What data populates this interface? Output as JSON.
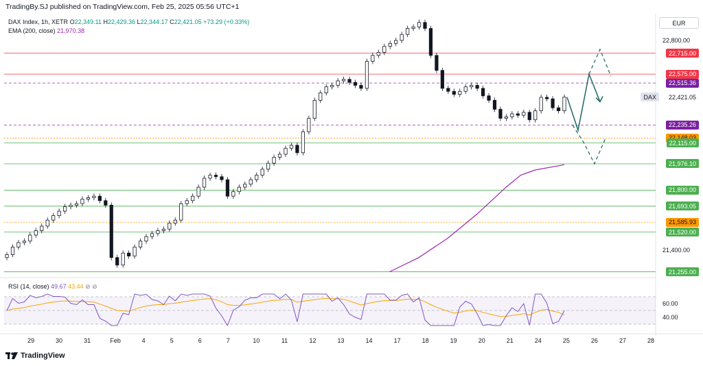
{
  "header": {
    "published": "TradingBy.SJ published on TradingView.com, Feb 25, 2025 05:56 UTC+1"
  },
  "legend": {
    "symbol": "DAX Index, 1h, XETR",
    "o_label": "O",
    "o_value": "22,349.11",
    "h_label": "H",
    "h_value": "22,429.36",
    "l_label": "L",
    "l_value": "22,344.17",
    "c_label": "C",
    "c_value": "22,421.05",
    "change": "+73.29 (+0.33%)",
    "ema_label": "EMA (200, close)",
    "ema_value": "21,970.38"
  },
  "rsi_legend": {
    "label": "RSI (14, close)",
    "value": "49.67",
    "ma_value": "43.44",
    "icons": "⊘ ⊘"
  },
  "currency": "EUR",
  "footer": {
    "brand": "TradingView"
  },
  "colors": {
    "up": "#089981",
    "down": "#131722",
    "ema": "#9c27b0",
    "red_line": "#f23645",
    "green_line": "#4caf50",
    "purple_dash": "#9c27b0",
    "orange_dot": "#ff9800",
    "projection": "#2a6f6b",
    "rsi": "#7e57c2",
    "rsi_ma": "#f7a600"
  },
  "chart_data": {
    "type": "candlestick",
    "symbol": "DAX",
    "last_price": 22421.05,
    "y_ticks": [
      21255,
      21400,
      21600,
      21800,
      22000,
      22200,
      22400,
      22600,
      22800
    ],
    "y_tick_labels": [
      "21,400.00",
      "22,800.00",
      "21,255.00"
    ],
    "x_tick_labels": [
      "29",
      "30",
      "31",
      "Feb",
      "4",
      "5",
      "6",
      "7",
      "10",
      "11",
      "12",
      "13",
      "14",
      "17",
      "18",
      "19",
      "20",
      "21",
      "24",
      "25",
      "26",
      "27",
      "28"
    ],
    "levels": [
      {
        "value": 22715.0,
        "label": "22,715.00",
        "style": "red"
      },
      {
        "value": 22575.0,
        "label": "22,575.00",
        "style": "red"
      },
      {
        "value": 22515.36,
        "label": "22,515.36",
        "style": "purple-dash"
      },
      {
        "value": 22421.05,
        "label": "22,421.05",
        "style": "last"
      },
      {
        "value": 22235.26,
        "label": "22,235.26",
        "style": "purple-dash"
      },
      {
        "value": 22148.03,
        "label": "22,148.03",
        "style": "orange-dot"
      },
      {
        "value": 22115.0,
        "label": "22,115.00",
        "style": "green"
      },
      {
        "value": 21976.1,
        "label": "21,976.10",
        "style": "green"
      },
      {
        "value": 21800.0,
        "label": "21,800.00",
        "style": "green"
      },
      {
        "value": 21693.05,
        "label": "21,693.05",
        "style": "green"
      },
      {
        "value": 21585.93,
        "label": "21,585.93",
        "style": "orange-dot"
      },
      {
        "value": 21520.0,
        "label": "21,520.00",
        "style": "green"
      },
      {
        "value": 21255.0,
        "label": "21,255.00",
        "style": "green"
      }
    ],
    "closes": [
      21370,
      21420,
      21450,
      21460,
      21500,
      21530,
      21560,
      21600,
      21630,
      21660,
      21690,
      21700,
      21710,
      21740,
      21750,
      21760,
      21730,
      21700,
      21350,
      21300,
      21380,
      21360,
      21420,
      21460,
      21490,
      21510,
      21530,
      21540,
      21580,
      21600,
      21710,
      21730,
      21760,
      21820,
      21880,
      21900,
      21890,
      21870,
      21760,
      21790,
      21820,
      21840,
      21870,
      21900,
      21940,
      21980,
      22020,
      22040,
      22080,
      22100,
      22050,
      22190,
      22280,
      22400,
      22450,
      22490,
      22500,
      22530,
      22540,
      22520,
      22500,
      22480,
      22660,
      22700,
      22720,
      22760,
      22780,
      22800,
      22840,
      22880,
      22890,
      22920,
      22880,
      22700,
      22600,
      22480,
      22460,
      22440,
      22460,
      22490,
      22500,
      22480,
      22430,
      22400,
      22340,
      22280,
      22290,
      22310,
      22300,
      22320,
      22270,
      22330,
      22420,
      22410,
      22350,
      22330,
      22421
    ],
    "ema": [
      [
        0.4,
        21255
      ],
      [
        0.5,
        21350
      ],
      [
        0.6,
        21480
      ],
      [
        0.7,
        21640
      ],
      [
        0.8,
        21820
      ],
      [
        0.85,
        21900
      ],
      [
        0.9,
        21935
      ],
      [
        1.0,
        21970
      ]
    ],
    "projection_solid": [
      [
        22421,
        0
      ],
      [
        22200,
        1
      ],
      [
        22575,
        2
      ],
      [
        22390,
        3
      ]
    ],
    "projection_dashed_up": [
      [
        22575,
        0
      ],
      [
        22740,
        1
      ],
      [
        22560,
        2
      ]
    ],
    "projection_dashed_down": [
      [
        22235,
        0
      ],
      [
        22120,
        1
      ],
      [
        21976,
        2
      ],
      [
        22148,
        3
      ]
    ],
    "rsi": {
      "labels": [
        "60.00",
        "40.00"
      ],
      "value": 49.67,
      "ma": 43.44
    }
  }
}
